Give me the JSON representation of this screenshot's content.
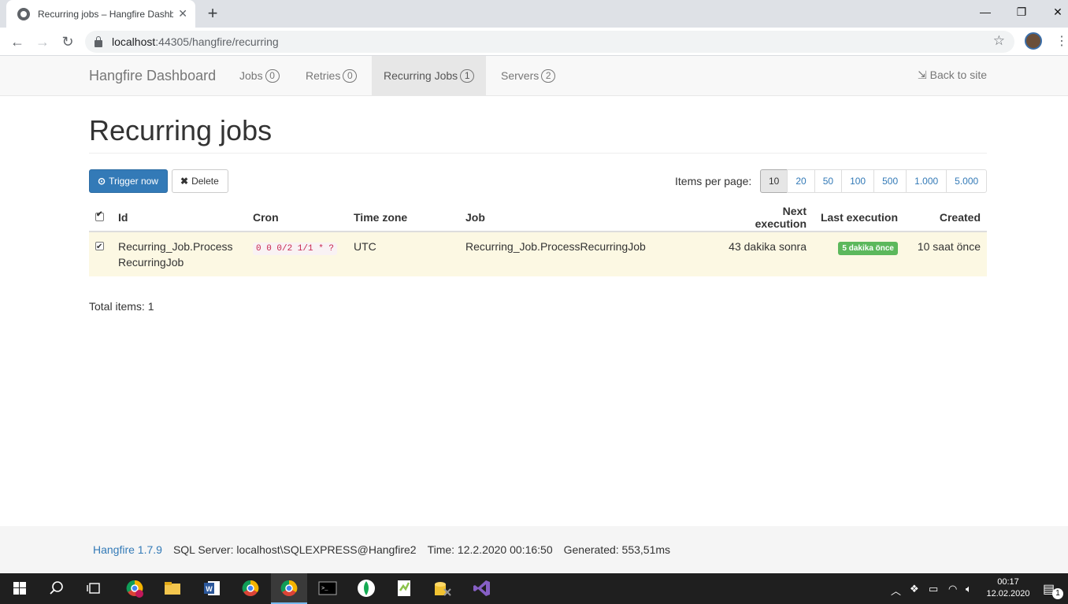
{
  "browser": {
    "tab_title": "Recurring jobs – Hangfire Dashbo",
    "url_host": "localhost",
    "url_rest": ":44305/hangfire/recurring"
  },
  "nav": {
    "brand": "Hangfire Dashboard",
    "items": [
      {
        "label": "Jobs",
        "count": "0"
      },
      {
        "label": "Retries",
        "count": "0"
      },
      {
        "label": "Recurring Jobs",
        "count": "1"
      },
      {
        "label": "Servers",
        "count": "2"
      }
    ],
    "back_to_site": "Back to site"
  },
  "page": {
    "title": "Recurring jobs",
    "trigger_label": "Trigger now",
    "delete_label": "Delete",
    "items_per_page_label": "Items per page:",
    "page_sizes": [
      "10",
      "20",
      "50",
      "100",
      "500",
      "1.000",
      "5.000"
    ],
    "selected_page_size": "10",
    "total_items": "Total items: 1"
  },
  "table": {
    "headers": [
      "Id",
      "Cron",
      "Time zone",
      "Job",
      "Next execution",
      "Last execution",
      "Created"
    ],
    "rows": [
      {
        "id_line1": "Recurring_Job.Process",
        "id_line2": "RecurringJob",
        "cron": "0 0 0/2 1/1 * ?",
        "time_zone": "UTC",
        "job": "Recurring_Job.ProcessRecurringJob",
        "next_execution": "43 dakika sonra",
        "last_execution": "5 dakika önce",
        "created": "10 saat önce",
        "checked": true
      }
    ]
  },
  "footer": {
    "version": "Hangfire 1.7.9",
    "storage": "SQL Server: localhost\\SQLEXPRESS@Hangfire2",
    "time": "Time: 12.2.2020 00:16:50",
    "generated": "Generated: 553,51ms"
  },
  "taskbar": {
    "time": "00:17",
    "date": "12.02.2020",
    "notification_count": "1"
  },
  "colors": {
    "primary": "#337ab7",
    "success": "#5cb85c",
    "row_highlight": "#fcf8e3",
    "cron_text": "#c7254e"
  }
}
